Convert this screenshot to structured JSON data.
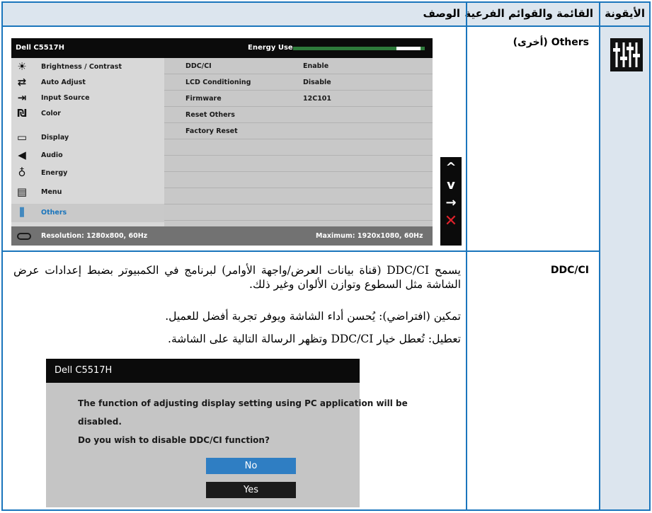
{
  "header": {
    "col_icon": "الأيقونة",
    "col_menu": "القائمة والقوائم الفرعية",
    "col_desc": "الوصف"
  },
  "row_others": {
    "label": "Others (أخرى)",
    "icon": "sliders-icon"
  },
  "osd": {
    "model": "Dell C5517H",
    "energy_label": "Energy Use",
    "menu_items": [
      {
        "icon": "brightness-icon",
        "label": "Brightness / Contrast"
      },
      {
        "icon": "auto-adjust-icon",
        "label": "Auto Adjust"
      },
      {
        "icon": "input-source-icon",
        "label": "Input Source"
      },
      {
        "icon": "color-icon",
        "label": "Color"
      },
      {
        "icon": "display-icon",
        "label": "Display"
      },
      {
        "icon": "audio-icon",
        "label": "Audio"
      },
      {
        "icon": "energy-icon",
        "label": "Energy"
      },
      {
        "icon": "menu-icon",
        "label": "Menu"
      },
      {
        "icon": "others-icon",
        "label": "Others"
      }
    ],
    "rows": [
      {
        "label": "DDC/CI",
        "value": "Enable"
      },
      {
        "label": "LCD Conditioning",
        "value": "Disable"
      },
      {
        "label": "Firmware",
        "value": "12C101"
      },
      {
        "label": "Reset Others",
        "value": ""
      },
      {
        "label": "Factory Reset",
        "value": ""
      }
    ],
    "resolution": "Resolution: 1280x800, 60Hz",
    "maximum": "Maximum: 1920x1080, 60Hz",
    "nav": [
      "up-arrow-icon",
      "down-arrow-icon",
      "right-arrow-icon",
      "close-icon"
    ]
  },
  "row_ddc": {
    "label": "DDC/CI",
    "p1": "يسمح DDC/CI (قناة بيانات العرض/واجهة الأوامر) لبرنامج في الكمبيوتر بضبط إعدادات عرض الشاشة مثل السطوع وتوازن الألوان وغير ذلك.",
    "p2": "تمكين (افتراضي): يُحسن أداء الشاشة ويوفر تجربة أفضل للعميل.",
    "p3": "تعطيل: تُعطل خيار DDC/CI وتظهر الرسالة التالية على الشاشة."
  },
  "dialog": {
    "title": "Dell C5517H",
    "line1": "The function of adjusting display setting using PC application will be",
    "line2": "disabled.",
    "line3": "Do you wish to disable DDC/CI function?",
    "no": "No",
    "yes": "Yes"
  }
}
